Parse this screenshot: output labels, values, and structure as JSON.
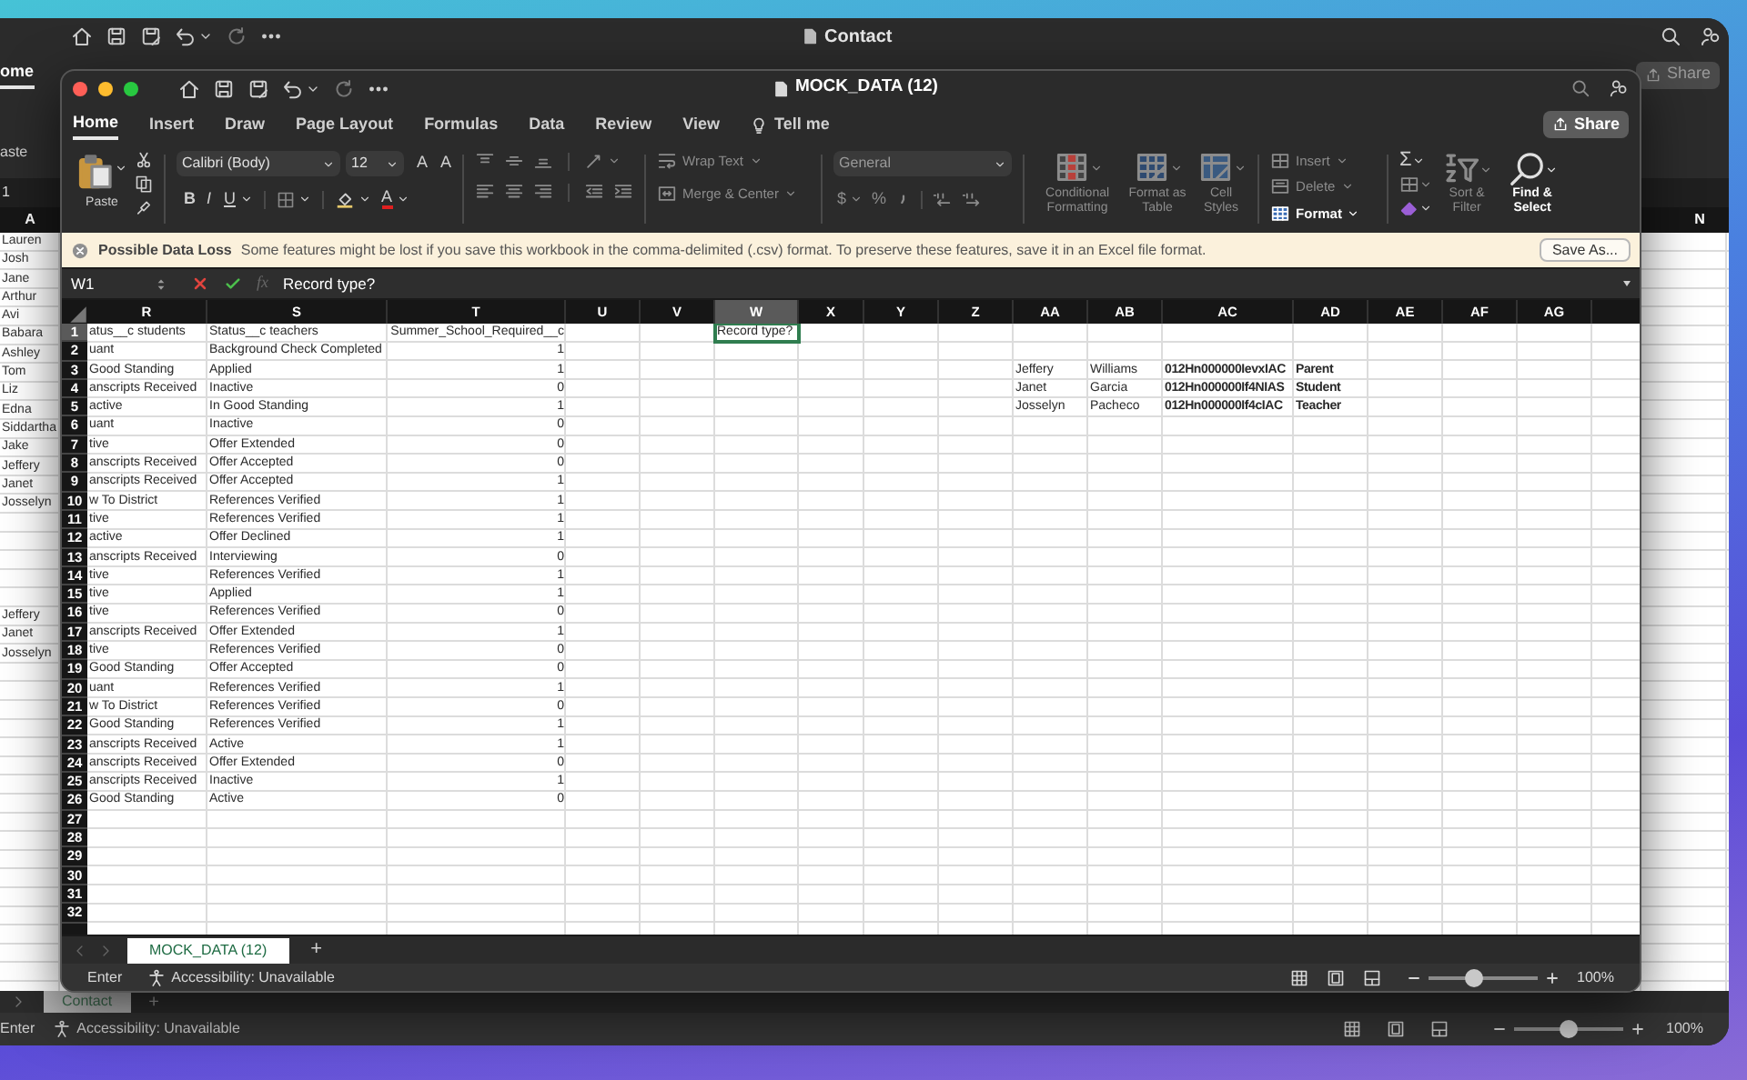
{
  "back_window": {
    "title": "Contact",
    "ribbon_tab": {
      "label": "ome",
      "selected": true
    },
    "paste_label": "aste",
    "share_button": "Share",
    "name_box": "1",
    "columns": [
      {
        "label": "A"
      },
      {
        "label": "N"
      }
    ],
    "column_a": [
      "Lauren",
      "Josh",
      "Jane",
      "Arthur",
      "Avi",
      "Babara",
      "Ashley",
      "Tom",
      "Liz",
      "Edna",
      "Siddartha",
      "Jake",
      "Jeffery",
      "Janet",
      "Josselyn"
    ],
    "column_a_lower": [
      "Jeffery",
      "Janet",
      "Josselyn"
    ],
    "sheet_tabs": [
      {
        "label": "Contact",
        "selected": true
      }
    ],
    "add_sheet": "+",
    "status_bar": {
      "mode": "Enter",
      "accessibility": "Accessibility: Unavailable",
      "zoom": {
        "level": 0.5,
        "reading": "100%"
      }
    }
  },
  "window": {
    "title": "MOCK_DATA (12)",
    "share_button": "Share",
    "tabs": [
      {
        "label": "Home",
        "selected": true,
        "kind": "tab"
      },
      {
        "label": "Insert",
        "selected": false,
        "kind": "tab"
      },
      {
        "label": "Draw",
        "selected": false,
        "kind": "tab"
      },
      {
        "label": "Page Layout",
        "selected": false,
        "kind": "tab"
      },
      {
        "label": "Formulas",
        "selected": false,
        "kind": "tab"
      },
      {
        "label": "Data",
        "selected": false,
        "kind": "tab"
      },
      {
        "label": "Review",
        "selected": false,
        "kind": "tab"
      },
      {
        "label": "View",
        "selected": false,
        "kind": "tab"
      },
      {
        "label": "Tell me",
        "selected": false,
        "kind": "search"
      }
    ],
    "ribbon": {
      "paste": "Paste",
      "font_name": "Calibri (Body)",
      "font_size": "12",
      "size_buttons": [
        "A",
        "A"
      ],
      "style_buttons": [
        "B",
        "I",
        "U"
      ],
      "font_color": "A",
      "alignment": [
        {
          "label": "Wrap Text",
          "disabled": true
        },
        {
          "label": "Merge & Center",
          "disabled": true
        }
      ],
      "number_format": "General",
      "number_buttons": [
        "$",
        "%"
      ],
      "styles": [
        {
          "label": "Conditional Formatting",
          "disabled": true
        },
        {
          "label": "Format as Table",
          "disabled": true
        },
        {
          "label": "Cell Styles",
          "disabled": true
        }
      ],
      "cells": [
        {
          "label": "Insert",
          "disabled": true
        },
        {
          "label": "Delete",
          "disabled": true
        },
        {
          "label": "Format",
          "disabled": false
        }
      ],
      "autosum": "Σ",
      "editing": [
        {
          "label": "Sort & Filter",
          "disabled": true
        },
        {
          "label": "Find & Select",
          "disabled": false
        }
      ]
    },
    "notification": {
      "title": "Possible Data Loss",
      "message": "Some features might be lost if you save this workbook in the comma-delimited (.csv) format. To preserve these features, save it in an Excel file format.",
      "button": "Save As..."
    },
    "formula_bar": {
      "name_box": "W1",
      "function_label": "fx",
      "value": "Record type?"
    },
    "sheet": {
      "columns": [
        {
          "label": "R",
          "selected": false,
          "numeric": false,
          "bold": false
        },
        {
          "label": "S",
          "selected": false,
          "numeric": false,
          "bold": false
        },
        {
          "label": "T",
          "selected": false,
          "numeric": true,
          "bold": false
        },
        {
          "label": "U",
          "selected": false
        },
        {
          "label": "V",
          "selected": false
        },
        {
          "label": "W",
          "selected": true,
          "numeric": false,
          "bold": false
        },
        {
          "label": "X",
          "selected": false
        },
        {
          "label": "Y",
          "selected": false
        },
        {
          "label": "Z",
          "selected": false
        },
        {
          "label": "AA",
          "selected": false,
          "numeric": false,
          "bold": false
        },
        {
          "label": "AB",
          "selected": false,
          "numeric": false,
          "bold": false
        },
        {
          "label": "AC",
          "selected": false,
          "numeric": false,
          "bold": true
        },
        {
          "label": "AD",
          "selected": false,
          "numeric": false,
          "bold": true
        },
        {
          "label": "AE",
          "selected": false
        },
        {
          "label": "AF",
          "selected": false
        },
        {
          "label": "AG",
          "selected": false
        }
      ],
      "rows": [
        {
          "number": "1",
          "selected": true,
          "cells": [
            "atus__c students",
            "Status__c teachers",
            "Summer_School_Required__c",
            null,
            null,
            "Record type?"
          ]
        },
        {
          "number": "2",
          "selected": false,
          "cells": [
            "uant",
            "Background Check Completed",
            "1"
          ]
        },
        {
          "number": "3",
          "selected": false,
          "cells": [
            "Good Standing",
            "Applied",
            "1",
            null,
            null,
            null,
            null,
            null,
            null,
            "Jeffery",
            "Williams",
            "012Hn000000IevxIAC",
            "Parent"
          ]
        },
        {
          "number": "4",
          "selected": false,
          "cells": [
            "anscripts Received",
            "Inactive",
            "0",
            null,
            null,
            null,
            null,
            null,
            null,
            "Janet",
            "Garcia",
            "012Hn000000If4NIAS",
            "Student"
          ]
        },
        {
          "number": "5",
          "selected": false,
          "cells": [
            "active",
            "In Good Standing",
            "1",
            null,
            null,
            null,
            null,
            null,
            null,
            "Josselyn",
            "Pacheco",
            "012Hn000000If4cIAC",
            "Teacher"
          ]
        },
        {
          "number": "6",
          "selected": false,
          "cells": [
            "uant",
            "Inactive",
            "0"
          ]
        },
        {
          "number": "7",
          "selected": false,
          "cells": [
            "tive",
            "Offer Extended",
            "0"
          ]
        },
        {
          "number": "8",
          "selected": false,
          "cells": [
            "anscripts Received",
            "Offer Accepted",
            "0"
          ]
        },
        {
          "number": "9",
          "selected": false,
          "cells": [
            "anscripts Received",
            "Offer Accepted",
            "1"
          ]
        },
        {
          "number": "10",
          "selected": false,
          "cells": [
            "w To District",
            "References Verified",
            "1"
          ]
        },
        {
          "number": "11",
          "selected": false,
          "cells": [
            "tive",
            "References Verified",
            "1"
          ]
        },
        {
          "number": "12",
          "selected": false,
          "cells": [
            "active",
            "Offer Declined",
            "1"
          ]
        },
        {
          "number": "13",
          "selected": false,
          "cells": [
            "anscripts Received",
            "Interviewing",
            "0"
          ]
        },
        {
          "number": "14",
          "selected": false,
          "cells": [
            "tive",
            "References Verified",
            "1"
          ]
        },
        {
          "number": "15",
          "selected": false,
          "cells": [
            "tive",
            "Applied",
            "1"
          ]
        },
        {
          "number": "16",
          "selected": false,
          "cells": [
            "tive",
            "References Verified",
            "0"
          ]
        },
        {
          "number": "17",
          "selected": false,
          "cells": [
            "anscripts Received",
            "Offer Extended",
            "1"
          ]
        },
        {
          "number": "18",
          "selected": false,
          "cells": [
            "tive",
            "References Verified",
            "0"
          ]
        },
        {
          "number": "19",
          "selected": false,
          "cells": [
            "Good Standing",
            "Offer Accepted",
            "0"
          ]
        },
        {
          "number": "20",
          "selected": false,
          "cells": [
            "uant",
            "References Verified",
            "1"
          ]
        },
        {
          "number": "21",
          "selected": false,
          "cells": [
            "w To District",
            "References Verified",
            "0"
          ]
        },
        {
          "number": "22",
          "selected": false,
          "cells": [
            "Good Standing",
            "References Verified",
            "1"
          ]
        },
        {
          "number": "23",
          "selected": false,
          "cells": [
            "anscripts Received",
            "Active",
            "1"
          ]
        },
        {
          "number": "24",
          "selected": false,
          "cells": [
            "anscripts Received",
            "Offer Extended",
            "0"
          ]
        },
        {
          "number": "25",
          "selected": false,
          "cells": [
            "anscripts Received",
            "Inactive",
            "1"
          ]
        },
        {
          "number": "26",
          "selected": false,
          "cells": [
            "Good Standing",
            "Active",
            "0"
          ]
        },
        {
          "number": "27",
          "selected": false
        },
        {
          "number": "28",
          "selected": false
        },
        {
          "number": "29",
          "selected": false
        },
        {
          "number": "30",
          "selected": false
        },
        {
          "number": "31",
          "selected": false
        },
        {
          "number": "32",
          "selected": false
        }
      ]
    },
    "sheet_tabs": [
      {
        "label": "MOCK_DATA (12)",
        "selected": true
      }
    ],
    "add_sheet": "+",
    "status_bar": {
      "mode": "Enter",
      "accessibility": "Accessibility: Unavailable",
      "zoom": {
        "level": 0.42,
        "reading": "100%"
      }
    }
  }
}
